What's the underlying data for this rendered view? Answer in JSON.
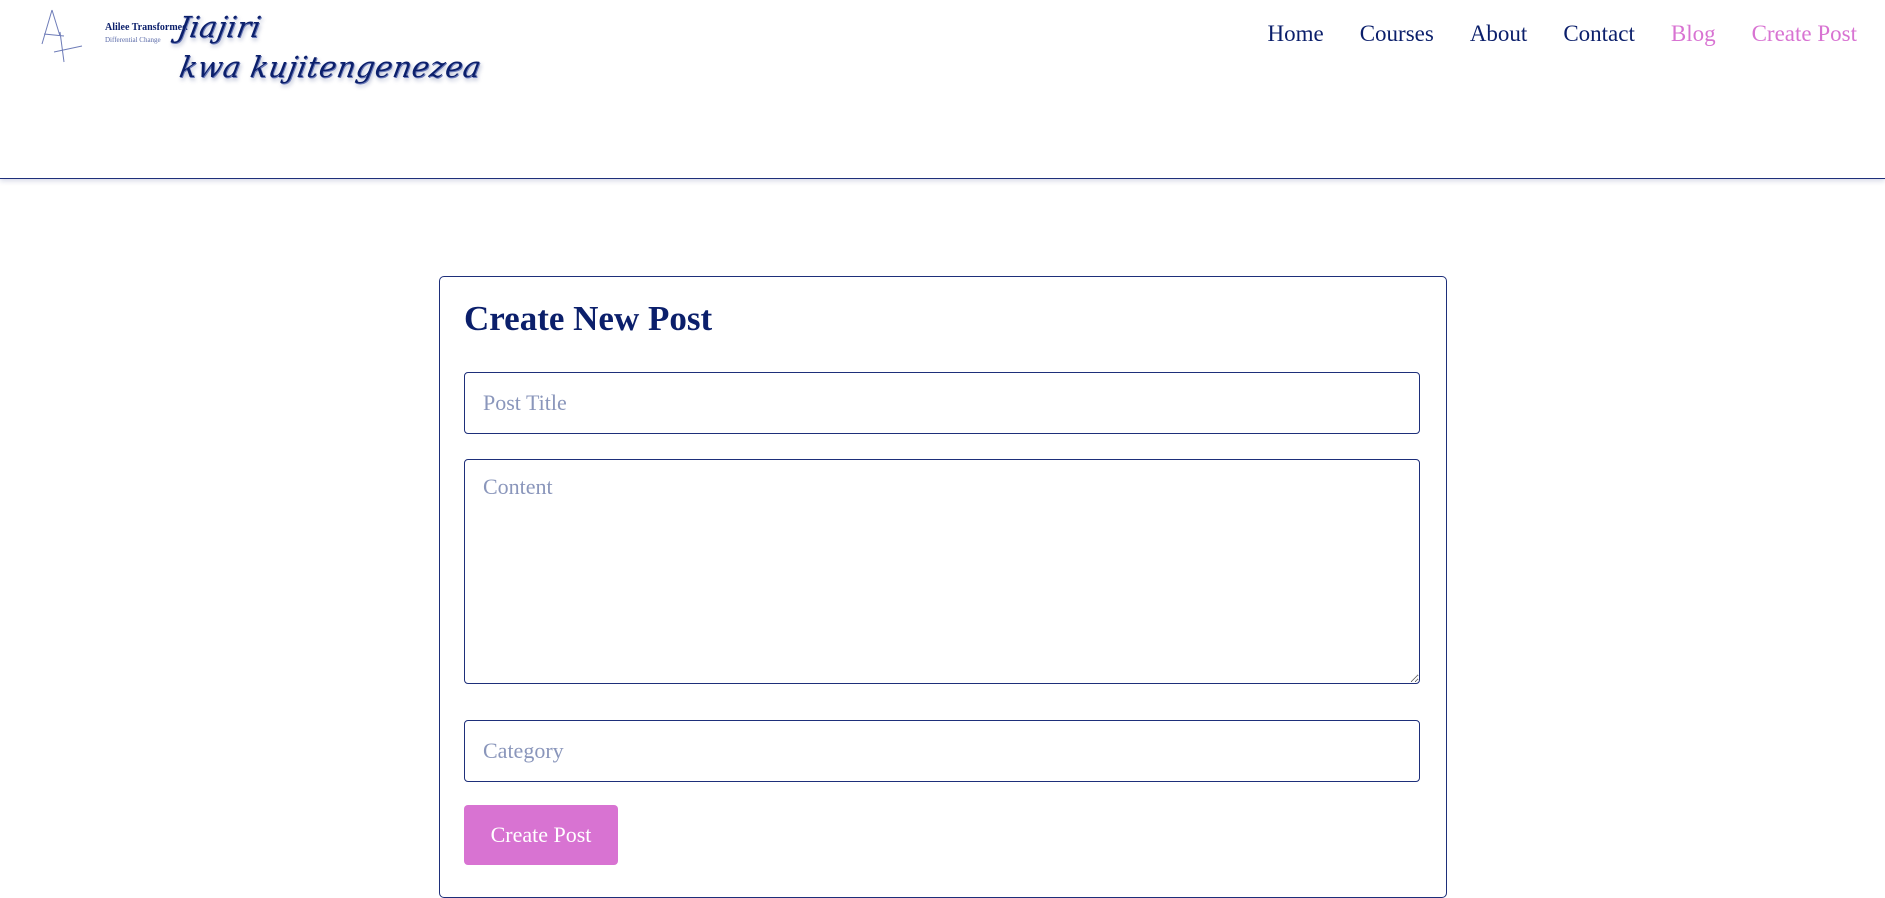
{
  "brand": {
    "name": "Alilee Transformed",
    "tagline": "Differential Change",
    "script_line1": "Jiajiri",
    "script_line2": "kwa kujitengenezea"
  },
  "nav": {
    "items": [
      "Home",
      "Courses",
      "About",
      "Contact",
      "Blog",
      "Create Post"
    ],
    "accent_color": "#d873d2",
    "text_color": "#0b1f6b"
  },
  "form": {
    "heading": "Create New Post",
    "title_placeholder": "Post Title",
    "title_value": "",
    "content_placeholder": "Content",
    "content_value": "",
    "category_placeholder": "Category",
    "category_value": "",
    "submit_label": "Create Post"
  }
}
